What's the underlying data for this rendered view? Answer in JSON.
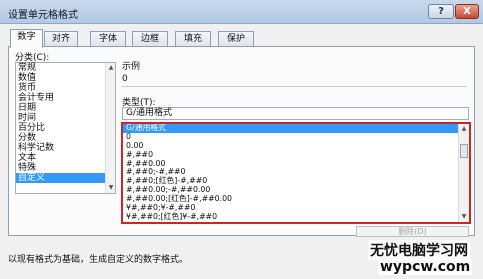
{
  "window": {
    "title": "设置单元格格式",
    "help_label": "?",
    "close_label": "X"
  },
  "tabs": [
    {
      "label": "数字"
    },
    {
      "label": "对齐"
    },
    {
      "label": "字体"
    },
    {
      "label": "边框"
    },
    {
      "label": "填充"
    },
    {
      "label": "保护"
    }
  ],
  "category": {
    "label": "分类(C):",
    "items": [
      "常规",
      "数值",
      "货币",
      "会计专用",
      "日期",
      "时间",
      "百分比",
      "分数",
      "科学记数",
      "文本",
      "特殊",
      "自定义"
    ],
    "selected_index": 11
  },
  "sample": {
    "label": "示例",
    "value": "0"
  },
  "type": {
    "label": "类型(T):",
    "input_value": "G/通用格式",
    "formats": [
      "G/通用格式",
      "0",
      "0.00",
      "#,##0",
      "#,##0.00",
      "#,##0;-#,##0",
      "#,##0;[红色]-#,##0",
      "#,##0.00;-#,##0.00",
      "#,##0.00;[红色]-#,##0.00",
      "¥#,##0;¥-#,##0",
      "¥#,##0;[红色]¥-#,##0"
    ],
    "selected_index": 0,
    "highlight_color": "#c62828"
  },
  "delete_button": {
    "label": "删除(D)"
  },
  "description": "以现有格式为基础，生成自定义的数字格式。",
  "watermark": {
    "line1": "无忧电脑学习网",
    "line2": "wypcw.com"
  }
}
